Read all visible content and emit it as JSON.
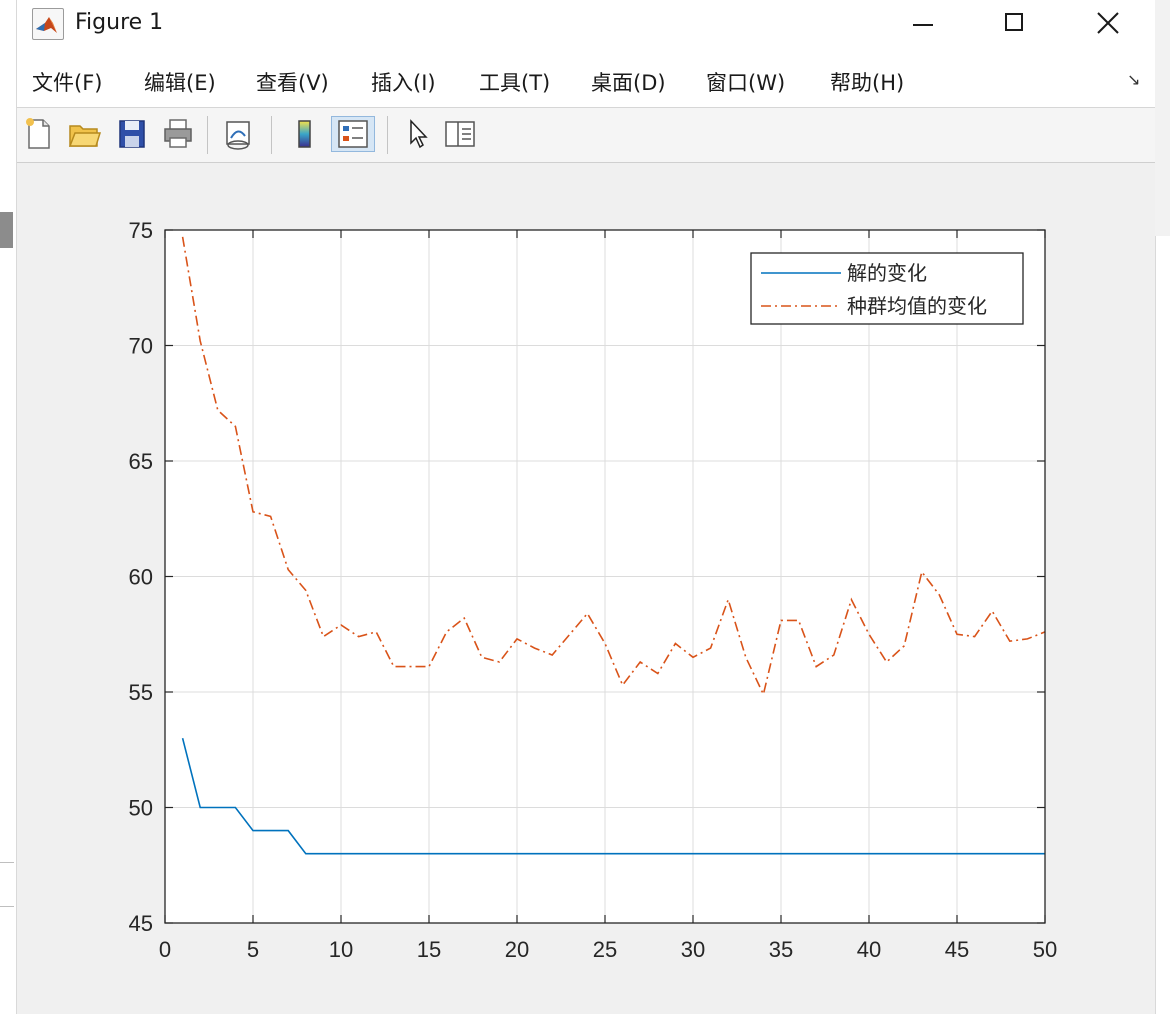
{
  "window": {
    "title": "Figure 1"
  },
  "menu": {
    "items": [
      {
        "label": "文件(F)"
      },
      {
        "label": "编辑(E)"
      },
      {
        "label": "查看(V)"
      },
      {
        "label": "插入(I)"
      },
      {
        "label": "工具(T)"
      },
      {
        "label": "桌面(D)"
      },
      {
        "label": "窗口(W)"
      },
      {
        "label": "帮助(H)"
      }
    ]
  },
  "toolbar": {
    "buttons": [
      {
        "icon": "new-figure-icon"
      },
      {
        "icon": "open-file-icon"
      },
      {
        "icon": "save-icon"
      },
      {
        "icon": "print-icon"
      },
      {
        "icon": "link-plot-icon"
      },
      {
        "icon": "colorbar-icon"
      },
      {
        "icon": "legend-icon",
        "active": true
      },
      {
        "icon": "edit-plot-icon"
      },
      {
        "icon": "property-inspector-icon"
      }
    ]
  },
  "chart_data": {
    "type": "line",
    "title": "",
    "xlabel": "",
    "ylabel": "",
    "xlim": [
      0,
      50
    ],
    "ylim": [
      45,
      75
    ],
    "xticks": [
      "0",
      "5",
      "10",
      "15",
      "20",
      "25",
      "30",
      "35",
      "40",
      "45",
      "50"
    ],
    "yticks": [
      "45",
      "50",
      "55",
      "60",
      "65",
      "70",
      "75"
    ],
    "grid": true,
    "legend_position": "top-right",
    "x": [
      1,
      2,
      3,
      4,
      5,
      6,
      7,
      8,
      9,
      10,
      11,
      12,
      13,
      14,
      15,
      16,
      17,
      18,
      19,
      20,
      21,
      22,
      23,
      24,
      25,
      26,
      27,
      28,
      29,
      30,
      31,
      32,
      33,
      34,
      35,
      36,
      37,
      38,
      39,
      40,
      41,
      42,
      43,
      44,
      45,
      46,
      47,
      48,
      49,
      50
    ],
    "series": [
      {
        "name": "解的变化",
        "color": "#0072BD",
        "style": "solid",
        "values": [
          53,
          50,
          50,
          50,
          49,
          49,
          49,
          48,
          48,
          48,
          48,
          48,
          48,
          48,
          48,
          48,
          48,
          48,
          48,
          48,
          48,
          48,
          48,
          48,
          48,
          48,
          48,
          48,
          48,
          48,
          48,
          48,
          48,
          48,
          48,
          48,
          48,
          48,
          48,
          48,
          48,
          48,
          48,
          48,
          48,
          48,
          48,
          48,
          48,
          48
        ]
      },
      {
        "name": "种群均值的变化",
        "color": "#D95319",
        "style": "dashdot",
        "values": [
          74.7,
          70.2,
          67.2,
          66.5,
          62.8,
          62.6,
          60.3,
          59.4,
          57.4,
          57.9,
          57.4,
          57.6,
          56.1,
          56.1,
          56.1,
          57.6,
          58.2,
          56.5,
          56.3,
          57.3,
          56.9,
          56.6,
          57.5,
          58.4,
          57.1,
          55.3,
          56.3,
          55.8,
          57.1,
          56.5,
          56.9,
          59,
          56.5,
          54.9,
          58.1,
          58.1,
          56.1,
          56.6,
          59,
          57.5,
          56.3,
          57,
          60.2,
          59.2,
          57.5,
          57.4,
          58.5,
          57.2,
          57.3,
          57.6
        ]
      }
    ]
  }
}
